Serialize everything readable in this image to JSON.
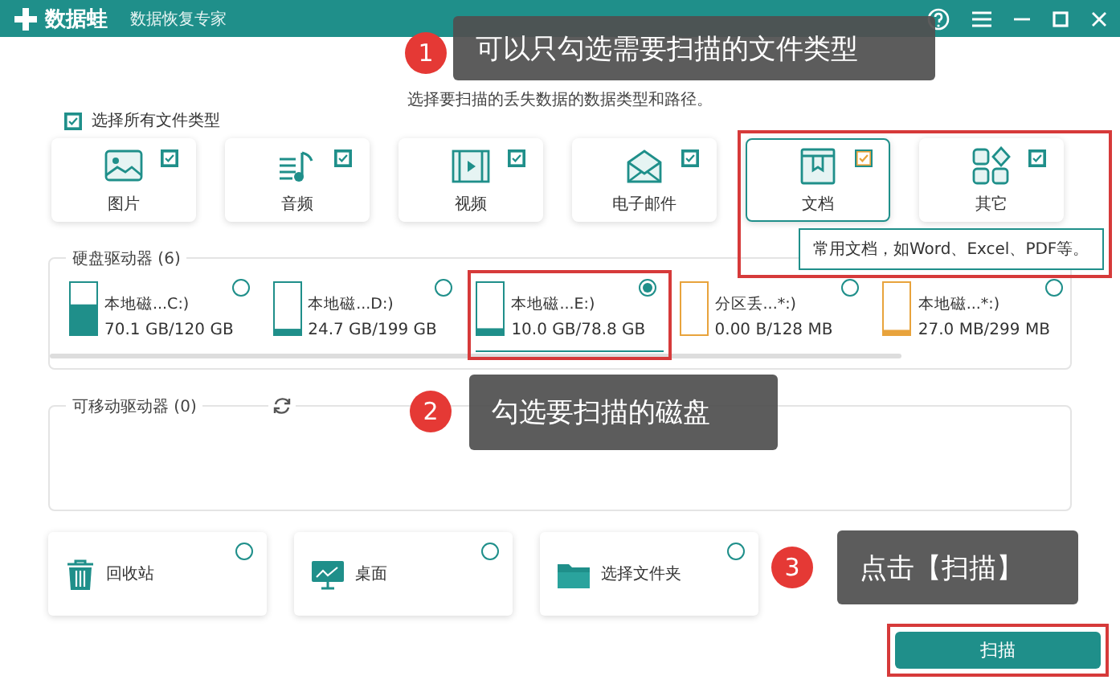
{
  "window": {
    "app_name": "数据蛙",
    "subtitle": "数据恢复专家"
  },
  "instruction": "选择要扫描的丢失数据的数据类型和路径。",
  "select_all": {
    "label": "选择所有文件类型",
    "checked": true
  },
  "file_types": [
    {
      "kind": "image",
      "label": "图片",
      "checked": true,
      "selected": false
    },
    {
      "kind": "audio",
      "label": "音频",
      "checked": true,
      "selected": false
    },
    {
      "kind": "video",
      "label": "视频",
      "checked": true,
      "selected": false
    },
    {
      "kind": "email",
      "label": "电子邮件",
      "checked": true,
      "selected": false
    },
    {
      "kind": "document",
      "label": "文档",
      "checked": true,
      "selected": true
    },
    {
      "kind": "other",
      "label": "其它",
      "checked": true,
      "selected": false
    }
  ],
  "tooltip": "常用文档，如Word、Excel、PDF等。",
  "hard_drives": {
    "title": "硬盘驱动器 (6)",
    "items": [
      {
        "name": "本地磁...C:)",
        "size": "70.1 GB/120 GB",
        "level": 0.58,
        "color": "#1f8f8a",
        "selected": false
      },
      {
        "name": "本地磁...D:)",
        "size": "24.7 GB/199 GB",
        "level": 0.12,
        "color": "#1f8f8a",
        "selected": false
      },
      {
        "name": "本地磁...E:)",
        "size": "10.0 GB/78.8 GB",
        "level": 0.13,
        "color": "#1f8f8a",
        "selected": true
      },
      {
        "name": "分区丢...*:)",
        "size": "0.00  B/128 MB",
        "level": 0,
        "color": "#e8a33c",
        "selected": false
      },
      {
        "name": "本地磁...*:)",
        "size": "27.0 MB/299 MB",
        "level": 0.1,
        "color": "#e8a33c",
        "selected": false
      }
    ]
  },
  "removable_drives": {
    "title": "可移动驱动器 (0)"
  },
  "locations": [
    {
      "kind": "recycle",
      "label": "回收站",
      "selected": false
    },
    {
      "kind": "desktop",
      "label": "桌面",
      "selected": false
    },
    {
      "kind": "folder",
      "label": "选择文件夹",
      "selected": false
    }
  ],
  "scan_button": "扫描",
  "callouts": [
    {
      "number": "1",
      "text": "可以只勾选需要扫描的文件类型"
    },
    {
      "number": "2",
      "text": "勾选要扫描的磁盘"
    },
    {
      "number": "3",
      "text": "点击【扫描】"
    }
  ]
}
